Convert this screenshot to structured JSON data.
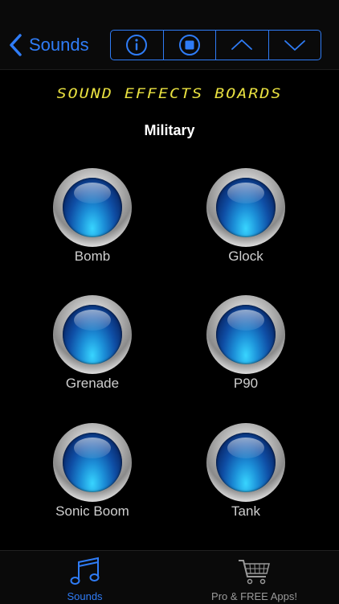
{
  "nav": {
    "back_label": "Sounds",
    "buttons": [
      {
        "icon": "info-icon"
      },
      {
        "icon": "stop-icon"
      },
      {
        "icon": "chevron-up-icon"
      },
      {
        "icon": "chevron-down-icon"
      }
    ],
    "accent": "#2f7cf6"
  },
  "header": {
    "title": "Sound Effects Boards",
    "category": "Military",
    "title_color": "#e8e040"
  },
  "sounds": [
    {
      "label": "Bomb"
    },
    {
      "label": "Glock"
    },
    {
      "label": "Grenade"
    },
    {
      "label": "P90"
    },
    {
      "label": "Sonic Boom"
    },
    {
      "label": "Tank"
    }
  ],
  "tabbar": {
    "tabs": [
      {
        "label": "Sounds",
        "icon": "music-notes-icon",
        "active": true
      },
      {
        "label": "Pro & FREE Apps!",
        "icon": "shopping-cart-icon",
        "active": false
      }
    ]
  }
}
